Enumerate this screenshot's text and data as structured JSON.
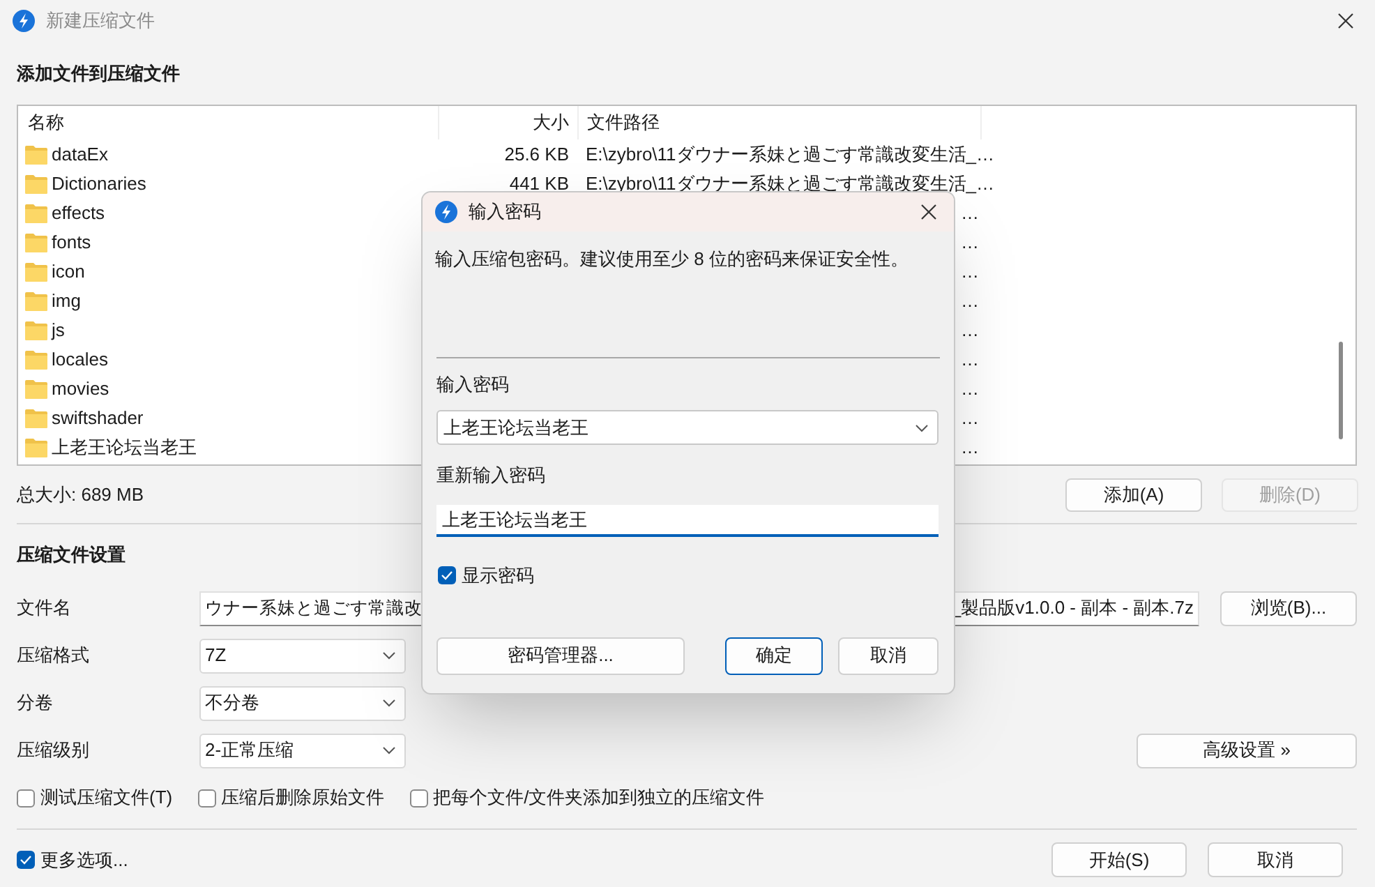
{
  "window": {
    "title": "新建压缩文件"
  },
  "files_section": {
    "title": "添加文件到压缩文件",
    "columns": [
      "名称",
      "大小",
      "文件路径"
    ],
    "rows": [
      {
        "name": "dataEx",
        "size": "25.6 KB",
        "path": "E:\\zybro\\11ダウナー系妹と過ごす常識改変生活_…"
      },
      {
        "name": "Dictionaries",
        "size": "441 KB",
        "path": "E:\\zybro\\11ダウナー系妹と過ごす常識改変生活_…"
      },
      {
        "name": "effects",
        "path": "…"
      },
      {
        "name": "fonts",
        "path": "…"
      },
      {
        "name": "icon",
        "path": "…"
      },
      {
        "name": "img",
        "path": "…"
      },
      {
        "name": "js",
        "path": "…"
      },
      {
        "name": "locales",
        "path": "…"
      },
      {
        "name": "movies",
        "path": "…"
      },
      {
        "name": "swiftshader",
        "path": "…"
      },
      {
        "name": "上老王论坛当老王",
        "path": "…"
      }
    ],
    "total_size": "总大小: 689 MB",
    "buttons": [
      {
        "label": "添加(A)",
        "disabled": false
      },
      {
        "label": "删除(D)",
        "disabled": true
      }
    ]
  },
  "settings": {
    "title": "压缩文件设置",
    "file_name": {
      "label": "文件名",
      "value_start": "ウナー系妹と過ごす常識改",
      "value_end": "_製品版v1.0.0 - 副本 - 副本.7z",
      "browse": "浏览(B)..."
    },
    "selects": [
      {
        "label": "压缩格式",
        "value": "7Z"
      },
      {
        "label": "分卷",
        "value": "不分卷"
      },
      {
        "label": "压缩级别",
        "value": "2-正常压缩"
      }
    ],
    "advanced_button": "高级设置 »",
    "options": [
      {
        "label": "测试压缩文件(T)",
        "checked": false
      },
      {
        "label": "压缩后删除原始文件",
        "checked": false
      },
      {
        "label": "把每个文件/文件夹添加到独立的压缩文件",
        "checked": false
      }
    ]
  },
  "footer": {
    "more_options": {
      "label": "更多选项...",
      "checked": true
    },
    "buttons": [
      "开始(S)",
      "取消"
    ]
  },
  "dialog": {
    "title": "输入密码",
    "message": "输入压缩包密码。建议使用至少 8 位的密码来保证安全性。",
    "password_label": "输入密码",
    "password": "上老王论坛当老王",
    "confirm_label": "重新输入密码",
    "confirm": "上老王论坛当老王",
    "show_password": {
      "label": "显示密码",
      "checked": true
    },
    "buttons": [
      {
        "label": "密码管理器...",
        "default": false
      },
      {
        "label": "确定",
        "default": true
      },
      {
        "label": "取消",
        "default": false
      }
    ]
  }
}
